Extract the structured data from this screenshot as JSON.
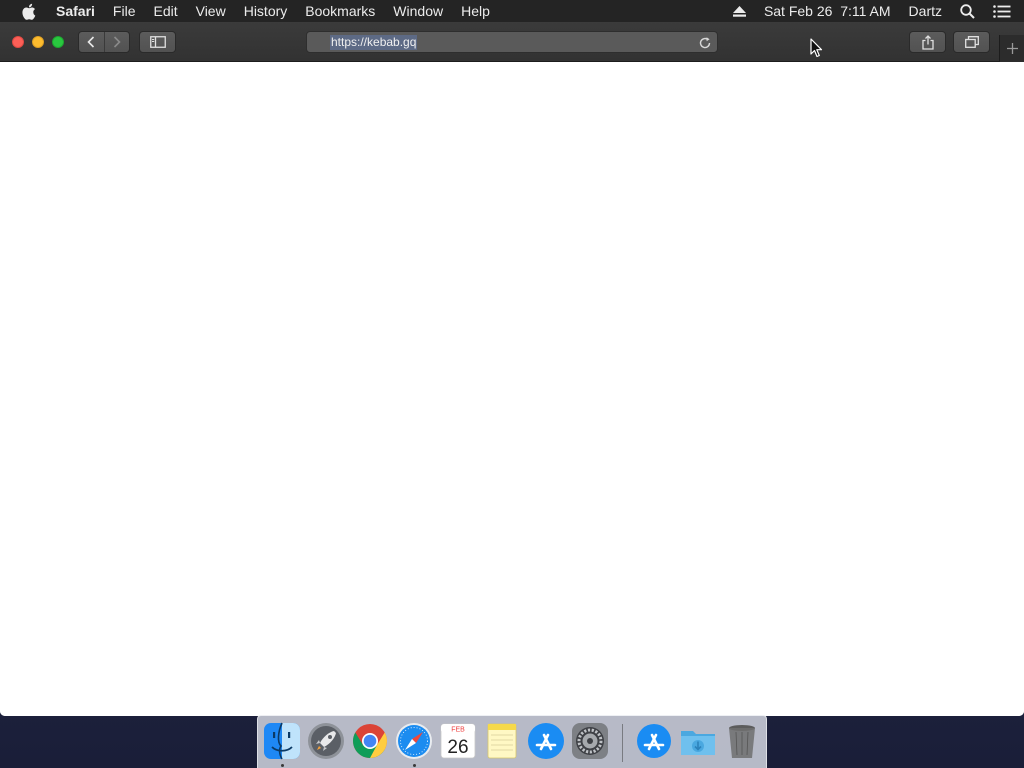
{
  "menubar": {
    "app_name": "Safari",
    "menus": [
      "File",
      "Edit",
      "View",
      "History",
      "Bookmarks",
      "Window",
      "Help"
    ],
    "status": {
      "eject_icon": "eject-icon",
      "datetime": "Sat Feb 26  7:11 AM",
      "user": "Dartz",
      "spotlight_icon": "search-icon",
      "notification_icon": "list-icon"
    }
  },
  "toolbar": {
    "url": "https://kebab.gq",
    "back_icon": "chevron-left-icon",
    "forward_icon": "chevron-right-icon",
    "sidebar_icon": "sidebar-icon",
    "share_icon": "share-icon",
    "tabs_icon": "tabs-icon",
    "new_tab_icon": "plus-icon",
    "reload_icon": "reload-icon"
  },
  "dock": {
    "calendar": {
      "month": "FEB",
      "day": "26"
    },
    "apps": [
      "Finder",
      "Launchpad",
      "Google Chrome",
      "Safari",
      "Calendar",
      "Notes",
      "App Store",
      "System Preferences",
      "Applications",
      "Downloads",
      "Trash"
    ]
  },
  "colors": {
    "menubar_bg": "#242424",
    "toolbar_bg": "#363636",
    "url_selection": "#5d6a85",
    "close": "#fc5f57",
    "minimize": "#fdbc2e",
    "maximize": "#29c73f"
  }
}
